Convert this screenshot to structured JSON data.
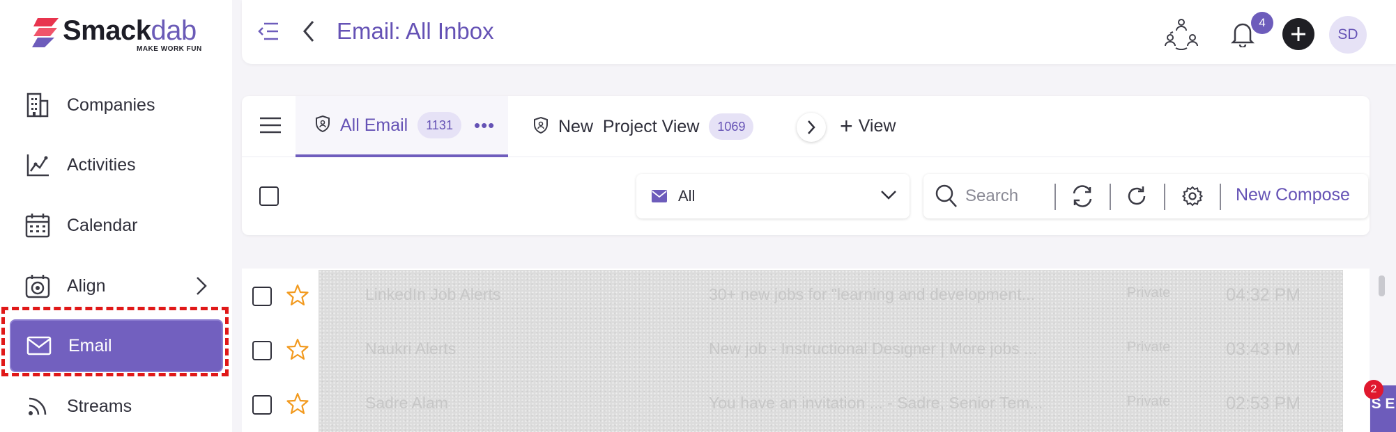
{
  "brand": {
    "name_main": "Smack",
    "name_accent": "dab",
    "tagline": "MAKE WORK FUN"
  },
  "sidebar": {
    "items": [
      {
        "label": "Companies",
        "icon": "building-icon"
      },
      {
        "label": "Activities",
        "icon": "activity-chart-icon"
      },
      {
        "label": "Calendar",
        "icon": "calendar-icon"
      },
      {
        "label": "Align",
        "icon": "target-icon",
        "has_submenu": true
      },
      {
        "label": "Email",
        "icon": "mail-icon",
        "active": true
      },
      {
        "label": "Streams",
        "icon": "rss-icon"
      }
    ]
  },
  "header": {
    "title": "Email: All Inbox",
    "notifications_count": "4",
    "avatar_initials": "SD"
  },
  "tabs": [
    {
      "label": "All Email",
      "count": "1131",
      "active": true
    },
    {
      "label": "New  Project View",
      "count": "1069",
      "active": false
    }
  ],
  "add_view_label": "View",
  "toolbar": {
    "filter_value": "All",
    "search_placeholder": "Search",
    "compose_label": "New Compose"
  },
  "emails": [
    {
      "sender": "LinkedIn Job Alerts",
      "subject": "30+ new jobs for \"learning and development...",
      "visibility": "Private",
      "time": "04:32 PM"
    },
    {
      "sender": "Naukri Alerts",
      "subject": "New job - Instructional Designer | More jobs ...",
      "visibility": "Private",
      "time": "03:43 PM"
    },
    {
      "sender": "Sadre Alam",
      "subject": "You have an invitation ... - Sadre, Senior Tem...",
      "visibility": "Private",
      "time": "02:53 PM"
    }
  ],
  "floating": {
    "badge": "2",
    "tab_text": "S E"
  },
  "colors": {
    "accent": "#6d5cbb",
    "active_nav": "#7260bf",
    "star": "#f29a1f",
    "highlight": "#e01818"
  }
}
